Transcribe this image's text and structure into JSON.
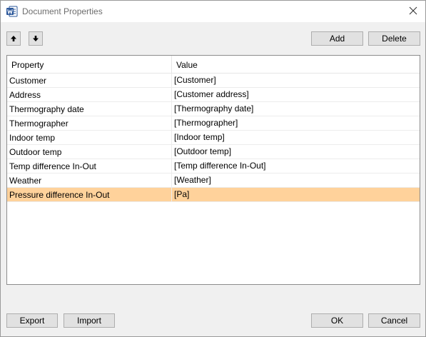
{
  "window": {
    "title": "Document Properties",
    "app_icon": "word-icon",
    "close_icon": "close-icon"
  },
  "toolbar": {
    "move_up_icon": "arrow-up-icon",
    "move_down_icon": "arrow-down-icon",
    "add_label": "Add",
    "delete_label": "Delete"
  },
  "table": {
    "headers": {
      "property": "Property",
      "value": "Value"
    },
    "rows": [
      {
        "property": "Customer",
        "value": "[Customer]"
      },
      {
        "property": "Address",
        "value": "[Customer address]"
      },
      {
        "property": "Thermography date",
        "value": "[Thermography date]"
      },
      {
        "property": "Thermographer",
        "value": "[Thermographer]"
      },
      {
        "property": "Indoor temp",
        "value": "[Indoor temp]"
      },
      {
        "property": "Outdoor temp",
        "value": "[Outdoor temp]"
      },
      {
        "property": "Temp difference In-Out",
        "value": "[Temp difference In-Out]"
      },
      {
        "property": "Weather",
        "value": "[Weather]"
      },
      {
        "property": "Pressure difference In-Out",
        "value": "[Pa]"
      }
    ],
    "selected_row_index": 8,
    "selection_color": "#ffd29b"
  },
  "footer": {
    "export_label": "Export",
    "import_label": "Import",
    "ok_label": "OK",
    "cancel_label": "Cancel"
  },
  "colors": {
    "word_brand": "#2b579a",
    "dialog_bg": "#f0f0f0",
    "button_bg": "#e1e1e1"
  }
}
